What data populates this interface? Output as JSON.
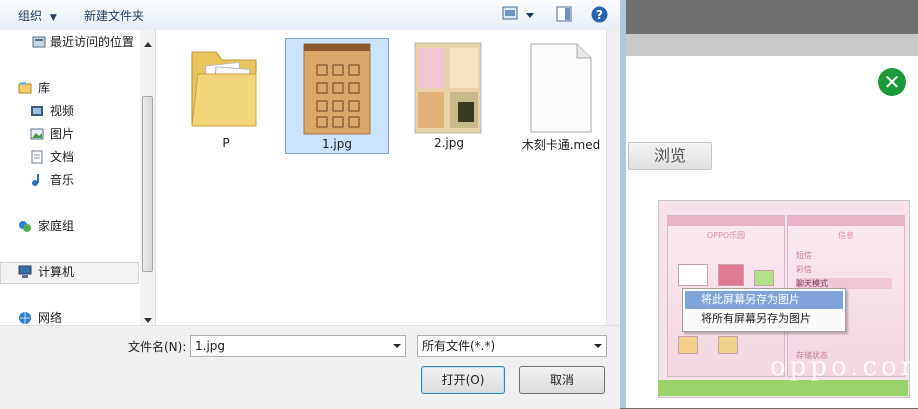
{
  "toolbar": {
    "organize_label": "组织",
    "new_folder_label": "新建文件夹"
  },
  "nav": {
    "items": [
      {
        "label": "最近访问的位置",
        "icon": "recent-places-icon"
      },
      {
        "label": "库",
        "icon": "library-icon"
      },
      {
        "label": "视频",
        "icon": "video-icon"
      },
      {
        "label": "图片",
        "icon": "pictures-icon"
      },
      {
        "label": "文档",
        "icon": "documents-icon"
      },
      {
        "label": "音乐",
        "icon": "music-icon"
      },
      {
        "label": "家庭组",
        "icon": "homegroup-icon"
      },
      {
        "label": "计算机",
        "icon": "computer-icon"
      },
      {
        "label": "网络",
        "icon": "network-icon"
      }
    ]
  },
  "files": [
    {
      "name": "P",
      "icon": "folder-icon",
      "selected": false
    },
    {
      "name": "1.jpg",
      "icon": "image-thumbnail-icon",
      "selected": true
    },
    {
      "name": "2.jpg",
      "icon": "image-thumbnail-icon",
      "selected": false
    },
    {
      "name": "木刻卡通.med",
      "icon": "blank-file-icon",
      "selected": false
    }
  ],
  "bottom": {
    "filename_label": "文件名(N):",
    "filename_value": "1.jpg",
    "filetype_value": "所有文件(*.*)",
    "open_label": "打开(O)",
    "cancel_label": "取消"
  },
  "page": {
    "browse_label": "浏览",
    "close_glyph": "✕",
    "context_menu": [
      "将此屏幕另存为图片",
      "将所有屏幕另存为图片"
    ],
    "watermark": "oppo.com",
    "phone_title": "OPPO乐园",
    "phone_menu": [
      "短信",
      "彩信",
      "聊天模式",
      "存储状态"
    ],
    "phone_menu_header": "信息"
  },
  "colors": {
    "accent": "#3c7fb1",
    "selection": "#cce4fb",
    "close_green": "#1b9a3a",
    "menu_highlight": "#7fa2d8"
  }
}
